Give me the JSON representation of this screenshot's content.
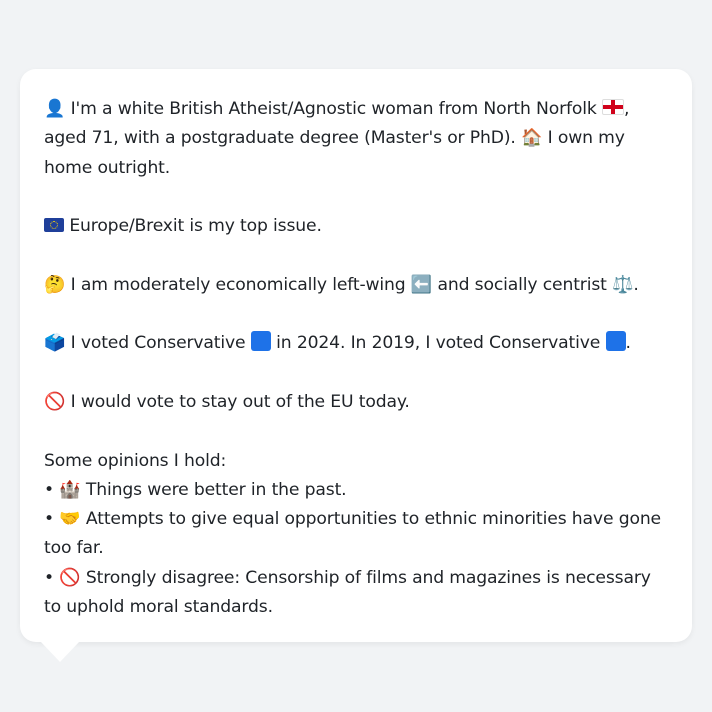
{
  "profile": {
    "intro": {
      "icon": "👤",
      "text_a": "I'm a white British Atheist/Agnostic woman from North Norfolk",
      "flag_icon": "england-flag-icon",
      "text_b": ", aged 71, with a postgraduate degree (Master's or PhD).",
      "home_icon": "🏠",
      "text_c": "I own my home outright."
    },
    "top_issue": {
      "flag_icon": "eu-flag-icon",
      "text": "Europe/Brexit is my top issue."
    },
    "ideology": {
      "icon": "🤔",
      "text_a": "I am moderately economically left-wing",
      "left_icon": "⬅️",
      "text_b": "and socially centrist",
      "scale_icon": "⚖️",
      "text_c": "."
    },
    "vote": {
      "icon": "🗳️",
      "text_a": "I voted Conservative",
      "text_b": "in 2024. In 2019, I voted Conservative",
      "text_c": ".",
      "party_color": "#1e72e8"
    },
    "eu_vote": {
      "icon": "🚫",
      "text": "I would vote to stay out of the EU today."
    },
    "opinions": {
      "heading": "Some opinions I hold:",
      "bullet": "•",
      "items": [
        {
          "icon": "🏰",
          "text": "Things were better in the past."
        },
        {
          "icon": "🤝",
          "text": "Attempts to give equal opportunities to ethnic minorities have gone too far."
        },
        {
          "icon": "🚫",
          "text": "Strongly disagree: Censorship of films and magazines is necessary to uphold moral standards."
        }
      ]
    }
  }
}
